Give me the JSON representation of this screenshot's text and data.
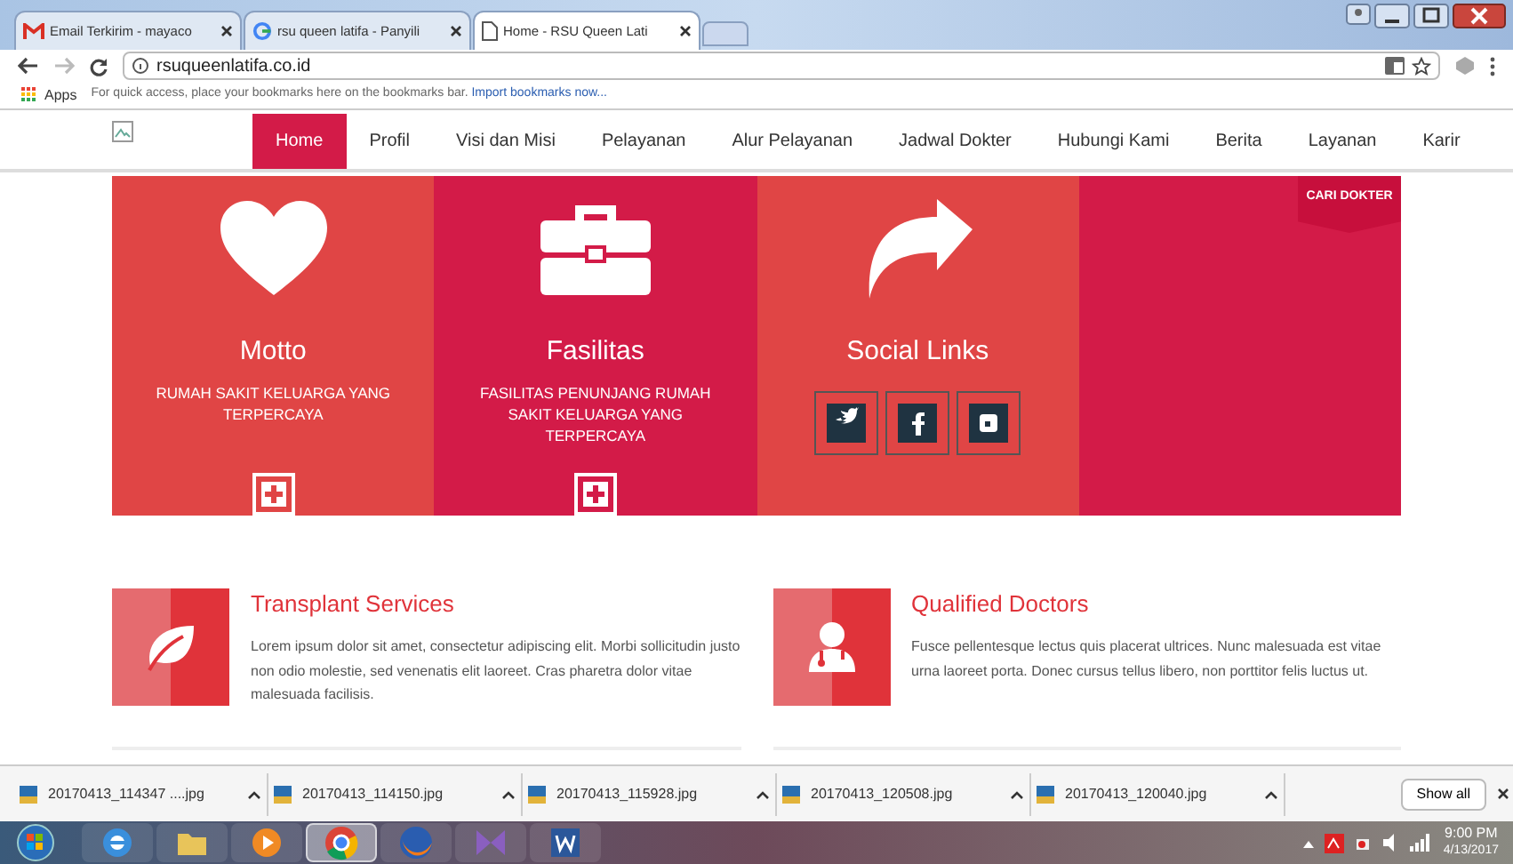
{
  "browser": {
    "tabs": [
      {
        "title": "Email Terkirim - mayaco",
        "kind": "mail",
        "selected": false
      },
      {
        "title": "rsu queen latifa - Panyili",
        "kind": "search",
        "selected": false
      },
      {
        "title": "Home - RSU Queen Lati",
        "kind": "page",
        "selected": true
      }
    ],
    "address": "rsuqueenlatifa.co.id",
    "bookmarks": {
      "apps": "Apps",
      "hint": "For quick access, place your bookmarks here on the bookmarks bar.",
      "link": "Import bookmarks now..."
    }
  },
  "nav": [
    {
      "label": "Home",
      "selected": true
    },
    {
      "label": "Profil",
      "selected": false
    },
    {
      "label": "Visi dan Misi",
      "selected": false
    },
    {
      "label": "Pelayanan",
      "selected": false
    },
    {
      "label": "Alur Pelayanan",
      "selected": false
    },
    {
      "label": "Jadwal Dokter",
      "selected": false
    },
    {
      "label": "Hubungi Kami",
      "selected": false
    },
    {
      "label": "Berita",
      "selected": false
    },
    {
      "label": "Layanan",
      "selected": false
    },
    {
      "label": "Karir",
      "selected": false
    }
  ],
  "features": [
    {
      "kind": "heart",
      "title": "Motto",
      "text": "RUMAH SAKIT KELUARGA YANG TERPERCAYA",
      "color": "#e04545"
    },
    {
      "kind": "briefcase",
      "title": "Fasilitas",
      "text": "FASILITAS PENUNJANG RUMAH SAKIT KELUARGA YANG TERPERCAYA",
      "color": "#d31b48"
    },
    {
      "kind": "share",
      "title": "Social Links",
      "color": "#e04545"
    },
    {
      "kind": "empty",
      "color": "#d31b48"
    }
  ],
  "ribbon": "CARI DOKTER",
  "services": [
    {
      "kind": "leaf",
      "title": "Transplant Services",
      "text": "Lorem ipsum dolor sit amet, consectetur adipiscing elit. Morbi sollicitudin justo non odio molestie, sed venenatis elit laoreet. Cras pharetra dolor vitae malesuada facilisis."
    },
    {
      "kind": "doctor",
      "title": "Qualified Doctors",
      "text": "Fusce pellentesque lectus quis placerat ultrices. Nunc malesuada est vitae urna laoreet porta. Donec cursus tellus libero, non porttitor felis luctus ut."
    }
  ],
  "downloads": [
    "20170413_114347 ....jpg",
    "20170413_114150.jpg",
    "20170413_115928.jpg",
    "20170413_120508.jpg",
    "20170413_120040.jpg"
  ],
  "show_all": "Show all",
  "taskbar": {
    "apps": [
      {
        "kind": "ie",
        "selected": false
      },
      {
        "kind": "folder",
        "selected": false
      },
      {
        "kind": "media",
        "selected": false
      },
      {
        "kind": "chrome",
        "selected": true
      },
      {
        "kind": "firefox",
        "selected": false
      },
      {
        "kind": "vs",
        "selected": false
      },
      {
        "kind": "word",
        "selected": false
      }
    ],
    "time": "9:00 PM",
    "date": "4/13/2017"
  }
}
